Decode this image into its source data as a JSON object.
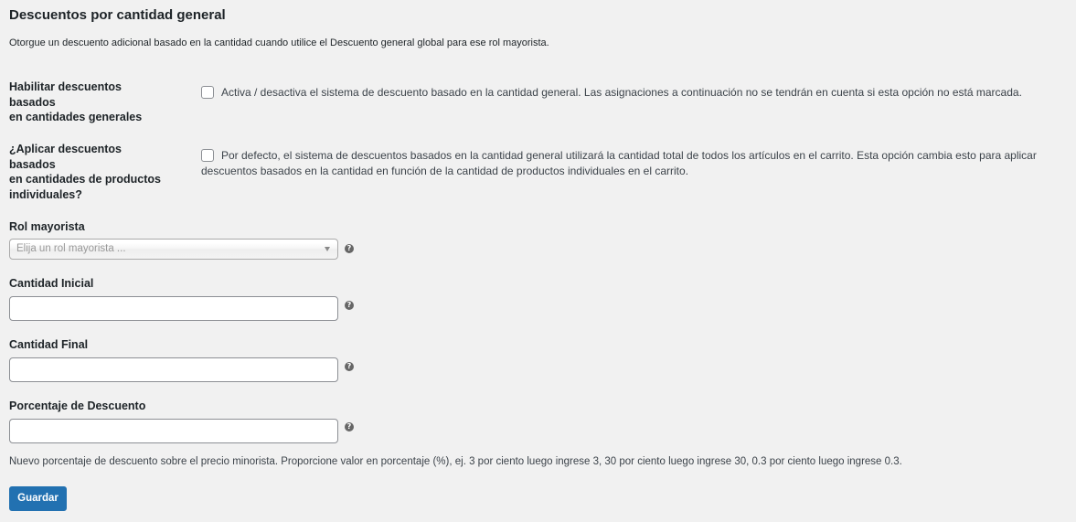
{
  "section": {
    "title": "Descuentos por cantidad general",
    "description": "Otorgue un descuento adicional basado en la cantidad cuando utilice el Descuento general global para ese rol mayorista."
  },
  "enable_general": {
    "label_line1": "Habilitar descuentos basados",
    "label_line2": "en cantidades generales",
    "checked": false,
    "description": "Activa / desactiva el sistema de descuento basado en la cantidad general. Las asignaciones a continuación no se tendrán en cuenta si esta opción no está marcada."
  },
  "individual_products": {
    "label_line1": "¿Aplicar descuentos basados",
    "label_line2": "en cantidades de productos",
    "label_line3": "individuales?",
    "checked": false,
    "description_line1": "Por defecto, el sistema de descuentos basados en la cantidad general utilizará la cantidad total de todos los artículos en el carrito. Esta opción cambia esto para aplicar",
    "description_line2": "descuentos basados en la cantidad en función de la cantidad de productos individuales en el carrito."
  },
  "wholesale_role": {
    "label": "Rol mayorista",
    "placeholder": "Elija un rol mayorista ...",
    "help_icon": "question-circle-icon"
  },
  "start_quantity": {
    "label": "Cantidad Inicial",
    "value": "",
    "help_icon": "question-circle-icon"
  },
  "end_quantity": {
    "label": "Cantidad Final",
    "value": "",
    "help_icon": "question-circle-icon"
  },
  "discount_percent": {
    "label": "Porcentaje de Descuento",
    "value": "",
    "help_icon": "question-circle-icon",
    "help_text": "Nuevo porcentaje de descuento sobre el precio minorista. Proporcione valor en porcentaje (%), ej. 3 por ciento luego ingrese 3, 30 por ciento luego ingrese 30, 0.3 por ciento luego ingrese 0.3."
  },
  "save_button": {
    "label": "Guardar",
    "color": "#2271b1"
  },
  "help_glyph": "?"
}
